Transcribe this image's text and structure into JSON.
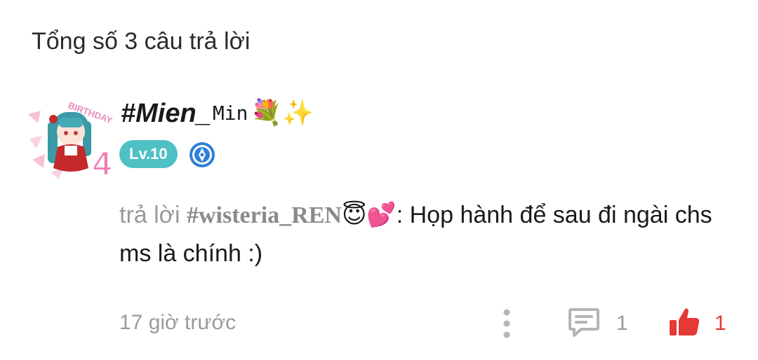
{
  "header": {
    "title": "Tổng số 3 câu trả lời"
  },
  "comment": {
    "avatar_text": "BIRTHDAY",
    "avatar_number": "4",
    "username_main": "#Mien_",
    "username_rest": "Min",
    "username_emoji": "💐✨",
    "level": "Lv.10",
    "reply_prefix": "trả lời",
    "reply_to": "#wisteria_REN",
    "reply_to_emoji": "😇💕",
    "reply_text": ": Họp hành để sau đi ngài chs ms là chính :)",
    "timestamp": "17 giờ trước",
    "comment_count": "1",
    "like_count": "1"
  },
  "colors": {
    "level_badge": "#4fc0c4",
    "like": "#e53935",
    "muted": "#9a9a9a",
    "title_badge": "#2f7fd8"
  },
  "icons": {
    "title_badge": "pen-badge-icon",
    "more": "more-vertical-icon",
    "comment": "comment-icon",
    "like": "thumbs-up-icon"
  }
}
